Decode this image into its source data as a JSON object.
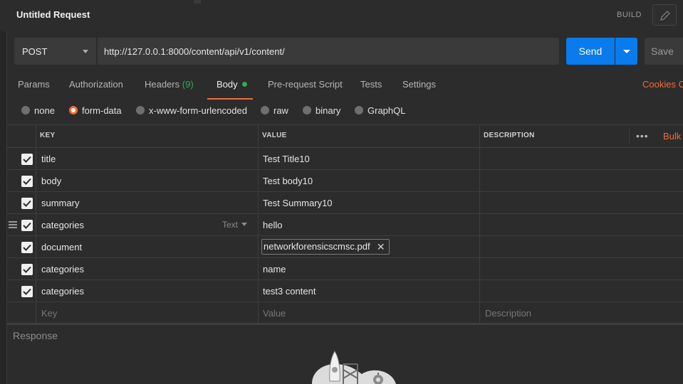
{
  "window": {
    "title": "Untitled Request",
    "build_label": "BUILD"
  },
  "request": {
    "method": "POST",
    "url": "http://127.0.0.1:8000/content/api/v1/content/",
    "send_label": "Send",
    "save_label": "Save"
  },
  "tabs": [
    {
      "label": "Params"
    },
    {
      "label": "Authorization"
    },
    {
      "label": "Headers",
      "count": "(9)"
    },
    {
      "label": "Body",
      "active": true
    },
    {
      "label": "Pre-request Script"
    },
    {
      "label": "Tests"
    },
    {
      "label": "Settings"
    }
  ],
  "cookies_label": "Cookies C",
  "body_types": [
    {
      "label": "none",
      "selected": false
    },
    {
      "label": "form-data",
      "selected": true
    },
    {
      "label": "x-www-form-urlencoded",
      "selected": false
    },
    {
      "label": "raw",
      "selected": false
    },
    {
      "label": "binary",
      "selected": false
    },
    {
      "label": "GraphQL",
      "selected": false
    }
  ],
  "table": {
    "headers": {
      "key": "KEY",
      "value": "VALUE",
      "description": "DESCRIPTION"
    },
    "more_label": "•••",
    "bulk_label": "Bulk",
    "rows": [
      {
        "key": "title",
        "value": "Test Title10",
        "checked": true
      },
      {
        "key": "body",
        "value": "Test body10",
        "checked": true
      },
      {
        "key": "summary",
        "value": "Test Summary10",
        "checked": true
      },
      {
        "key": "categories",
        "value": "hello",
        "checked": true,
        "type": "Text"
      },
      {
        "key": "document",
        "value": "networkforensicscmsc.pdf",
        "checked": true,
        "is_file": true
      },
      {
        "key": "categories",
        "value": "name",
        "checked": true
      },
      {
        "key": "categories",
        "value": "test3 content",
        "checked": true
      }
    ],
    "placeholders": {
      "key": "Key",
      "value": "Value",
      "description": "Description"
    }
  },
  "response": {
    "label": "Response"
  },
  "colors": {
    "accent": "#f26b3a",
    "send": "#097bed",
    "active_dot": "#3aa757",
    "background": "#2c2c2c"
  }
}
